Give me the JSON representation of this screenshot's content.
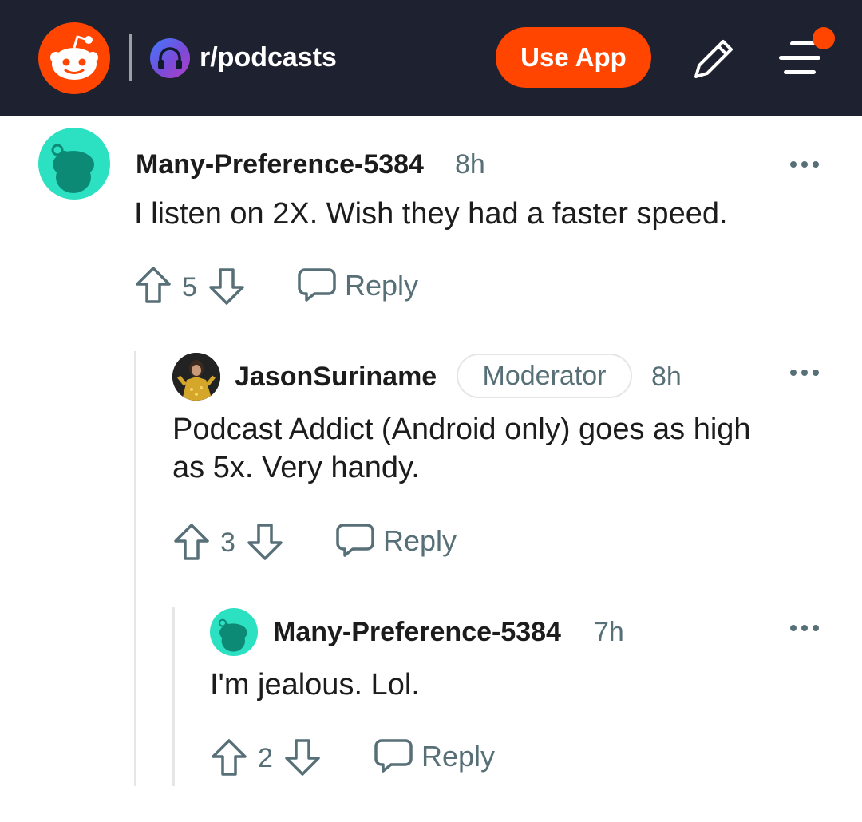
{
  "header": {
    "subreddit": "r/podcasts",
    "use_app_label": "Use App",
    "icons": [
      "reddit-logo-icon",
      "headphones-icon",
      "pencil-icon",
      "menu-icon"
    ],
    "colors": {
      "bar": "#1e2230",
      "accent": "#ff4500",
      "notification": "#ff4500"
    }
  },
  "comments": [
    {
      "username": "Many-Preference-5384",
      "time": "8h",
      "body": "I listen on 2X. Wish they had a faster speed.",
      "votes": "5",
      "reply_label": "Reply"
    },
    {
      "username": "JasonSuriname",
      "badge": "Moderator",
      "time": "8h",
      "body_line1": "Podcast Addict (Android only) goes as high",
      "body_line2": "as 5x. Very handy.",
      "votes": "3",
      "reply_label": "Reply"
    },
    {
      "username": "Many-Preference-5384",
      "time": "7h",
      "body": "I'm jealous. Lol.",
      "votes": "2",
      "reply_label": "Reply"
    }
  ]
}
